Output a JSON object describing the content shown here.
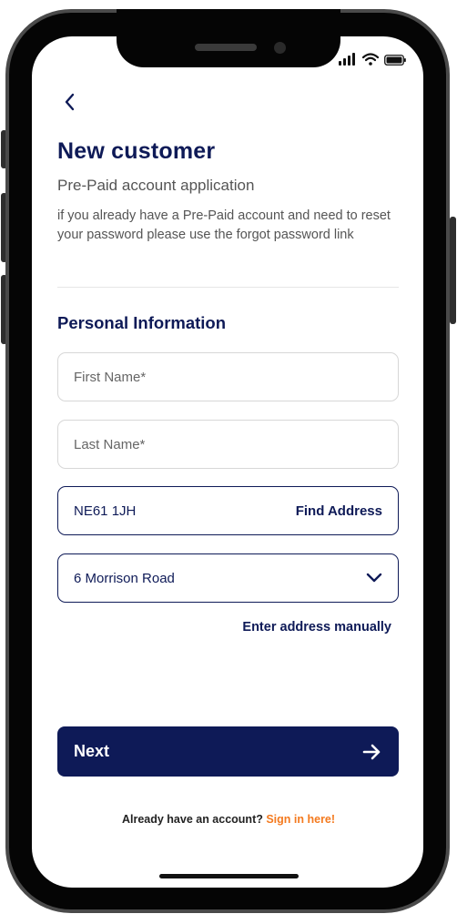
{
  "header": {
    "title": "New customer",
    "subtitle": "Pre-Paid account application",
    "description": "if you already have a Pre-Paid account and need to reset your password please use the forgot password link"
  },
  "form": {
    "section_title": "Personal Information",
    "first_name_placeholder": "First Name*",
    "last_name_placeholder": "Last Name*",
    "postcode_value": "NE61 1JH",
    "find_address_label": "Find Address",
    "address_selected": "6 Morrison Road",
    "enter_manually_label": "Enter address manually"
  },
  "actions": {
    "next_label": "Next"
  },
  "footer": {
    "prompt": "Already have an account?",
    "sign_in_label": "Sign in here!"
  },
  "colors": {
    "brand_navy": "#0e1a57",
    "link_orange": "#f47a1f"
  },
  "icons": [
    "back-chevron-icon",
    "chevron-down-icon",
    "arrow-right-icon",
    "signal-icon",
    "wifi-icon",
    "battery-icon"
  ]
}
